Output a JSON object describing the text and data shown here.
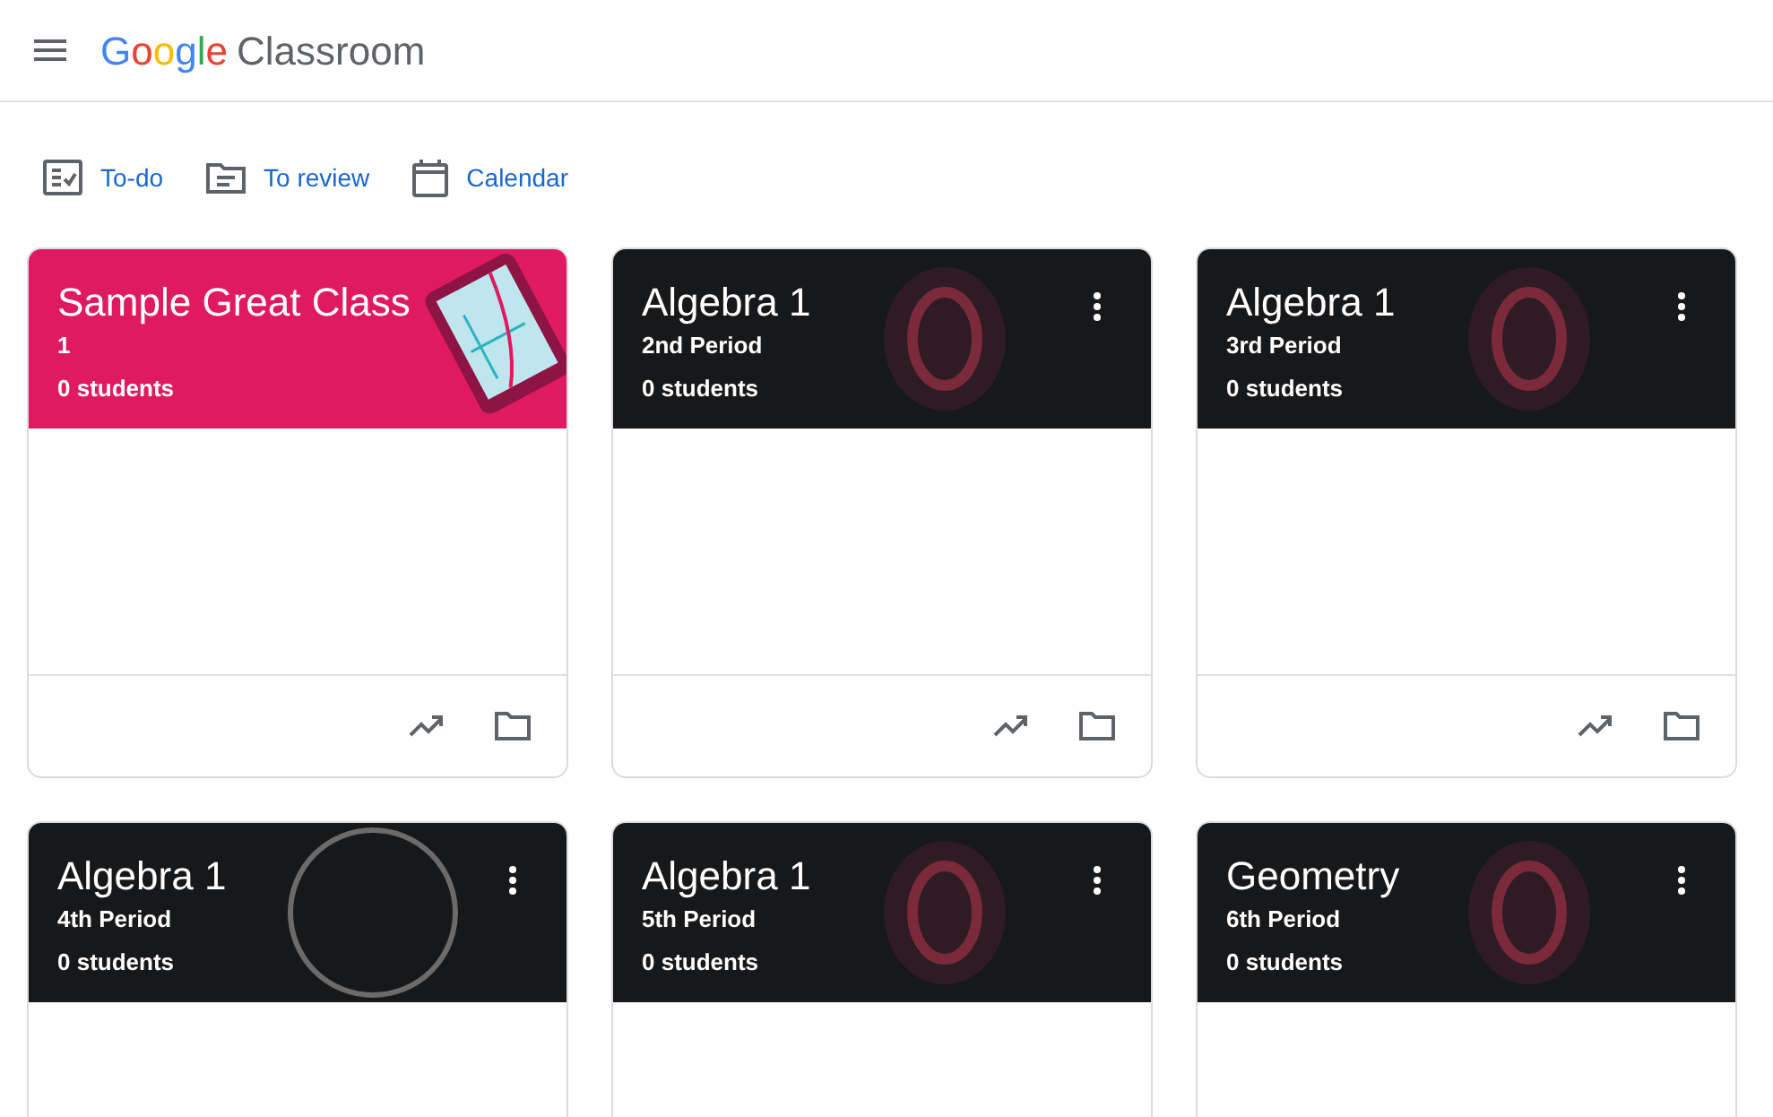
{
  "app_bar": {
    "logo_word": "Google",
    "product": "Classroom"
  },
  "nav": [
    {
      "kind": "todo",
      "label": "To-do"
    },
    {
      "kind": "review",
      "label": "To review"
    },
    {
      "kind": "calendar",
      "label": "Calendar"
    }
  ],
  "classes": [
    {
      "title": "Sample Great Class",
      "section": "1",
      "students": "0 students",
      "color": "#e01a5f",
      "kind": "tablet",
      "menu": false
    },
    {
      "title": "Algebra 1",
      "section": "2nd Period",
      "students": "0 students",
      "color": "#17181a",
      "kind": "glow",
      "menu": true
    },
    {
      "title": "Algebra 1",
      "section": "3rd Period",
      "students": "0 students",
      "color": "#17181a",
      "kind": "glow",
      "menu": true
    },
    {
      "title": "Algebra 1",
      "section": "4th Period",
      "students": "0 students",
      "color": "#17181a",
      "kind": "ring",
      "menu": true
    },
    {
      "title": "Algebra 1",
      "section": "5th Period",
      "students": "0 students",
      "color": "#17181a",
      "kind": "glow",
      "menu": true
    },
    {
      "title": "Geometry",
      "section": "6th Period",
      "students": "0 students",
      "color": "#17181a",
      "kind": "glow",
      "menu": true
    }
  ]
}
